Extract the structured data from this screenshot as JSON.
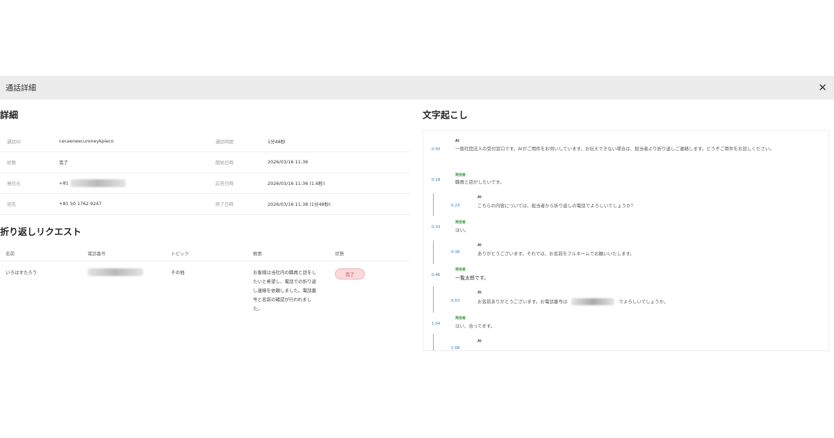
{
  "modal": {
    "title": "通話詳細"
  },
  "details": {
    "title": "詳細",
    "rows": [
      {
        "k1": "通話ID",
        "v1": "cecaeneecuroneykpieco",
        "k2": "通話時間",
        "v2": "1分48秒"
      },
      {
        "k1": "状態",
        "v1": "完了",
        "k2": "開始日時",
        "v2": "2026/03/16 11:36"
      },
      {
        "k1": "発信元",
        "v1": "+81",
        "k2": "応答日時",
        "v2": "2026/03/16 11:36 (1.6秒)"
      },
      {
        "k1": "宛先",
        "v1": "+81 50 1762 9247",
        "k2": "終了日時",
        "v2": "2026/03/16 11:38 (1分48秒)"
      }
    ]
  },
  "callback": {
    "title": "折り返しリクエスト",
    "headers": [
      "名前",
      "電話番号",
      "トピック",
      "概要",
      "状態"
    ],
    "row": {
      "name": "いろはすたろう",
      "topic": "その他",
      "summary": "お客様は当社内の職員と話をしたいと希望し、電話での折り返し連絡を依頼しました。電話番号と名前の確認が行われました。",
      "status": "完了"
    }
  },
  "transcript": {
    "title": "文字起こし",
    "turns": [
      {
        "time": "0:00",
        "speaker": "AI",
        "text": "一般社団法人の受付窓口です。AIがご用件をお伺いしています。お伝えできない場合は、担当者より折り返しご連絡します。どうぞご用件をお話しください。"
      },
      {
        "time": "0:18",
        "speaker": "発信者",
        "text": "職員と話がしたいです。"
      },
      {
        "time": "0:23",
        "speaker": "AI",
        "text": "こちらの内容については、担当者から折り返しの電話でよろしいでしょうか？"
      },
      {
        "time": "0:33",
        "speaker": "発信者",
        "text": "はい。"
      },
      {
        "time": "0:38",
        "speaker": "AI",
        "text": "ありがとうございます。それでは、お名前をフルネームでお願いいたします。"
      },
      {
        "time": "0:46",
        "speaker": "発信者",
        "text": "一覧太郎です。"
      },
      {
        "time": "0:53",
        "speaker": "AI",
        "text_a": "お名前ありがとうございます。お電話番号は",
        "text_b": "でよろしいでしょうか。"
      },
      {
        "time": "1:04",
        "speaker": "発信者",
        "text": "はい、合ってます。"
      },
      {
        "time": "1:08",
        "speaker": "AI",
        "text": ""
      }
    ]
  }
}
